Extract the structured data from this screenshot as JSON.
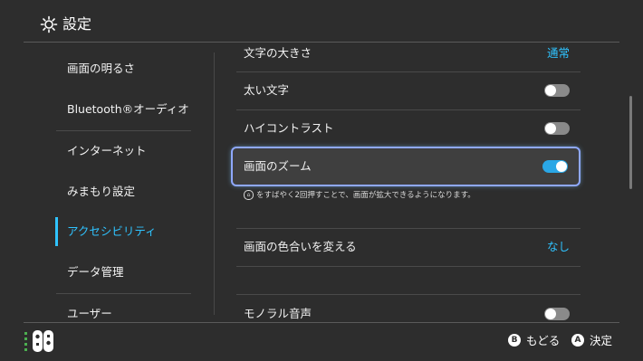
{
  "header": {
    "title": "設定",
    "icon": "gear-icon"
  },
  "sidebar": {
    "items": [
      {
        "label": "画面の明るさ"
      },
      {
        "label": "Bluetooth®オーディオ"
      },
      {
        "label": "インターネット"
      },
      {
        "label": "みまもり設定"
      },
      {
        "label": "アクセシビリティ",
        "active": true
      },
      {
        "label": "データ管理"
      },
      {
        "label": "ユーザー"
      }
    ]
  },
  "settings": {
    "font_size": {
      "label": "文字の大きさ",
      "value": "通常"
    },
    "bold_text": {
      "label": "太い文字",
      "on": false
    },
    "high_contrast": {
      "label": "ハイコントラスト",
      "on": false
    },
    "zoom": {
      "label": "画面のズーム",
      "on": true,
      "note": "をすばやく2回押すことで、画面が拡大できるようになります。",
      "note_icon": "home-button-icon",
      "note_icon_glyph": "⌂"
    },
    "color_filter": {
      "label": "画面の色合いを変える",
      "value": "なし"
    },
    "mono_audio": {
      "label": "モノラル音声",
      "on": false
    }
  },
  "footer": {
    "back": {
      "button": "B",
      "label": "もどる"
    },
    "confirm": {
      "button": "A",
      "label": "決定"
    }
  },
  "colors": {
    "accent": "#2fc3ff",
    "background": "#2d2d2d",
    "toggle_on": "#2aa7e6",
    "focus_ring": "#8fa8ff"
  }
}
